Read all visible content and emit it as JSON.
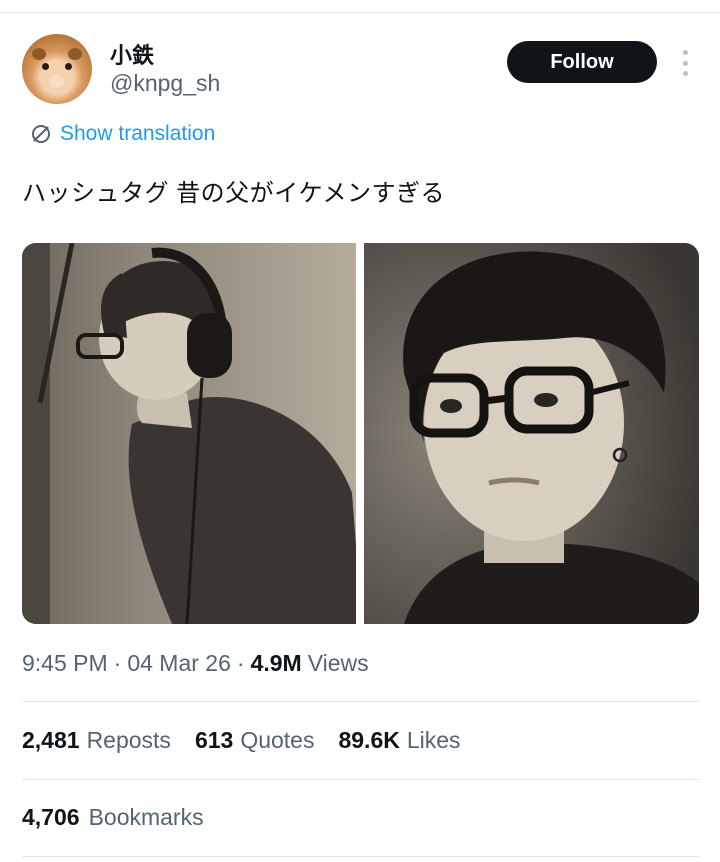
{
  "tweet": {
    "author": {
      "display_name": "小鉄",
      "handle": "@knpg_sh",
      "avatar_icon": "guinea-pig-avatar"
    },
    "follow_label": "Follow",
    "more_icon": "more-vertical-icon",
    "translation": {
      "icon": "translate-icon",
      "label": "Show translation"
    },
    "text": "ハッシュタグ 昔の父がイケメンすぎる",
    "media": [
      {
        "description_icon": "photo-headphones-profile"
      },
      {
        "description_icon": "photo-glasses-portrait"
      }
    ],
    "meta": {
      "time": "9:45 PM",
      "date": "04 Mar 26",
      "views_count": "4.9M",
      "views_label": "Views",
      "separator": "·"
    },
    "stats": {
      "reposts_count": "2,481",
      "reposts_label": "Reposts",
      "quotes_count": "613",
      "quotes_label": "Quotes",
      "likes_count": "89.6K",
      "likes_label": "Likes",
      "bookmarks_count": "4,706",
      "bookmarks_label": "Bookmarks"
    }
  },
  "colors": {
    "text_primary": "#0f1419",
    "text_secondary": "#536471",
    "link": "#1d9bf0",
    "button_bg": "#0f1419",
    "divider": "#e1e4e8"
  }
}
